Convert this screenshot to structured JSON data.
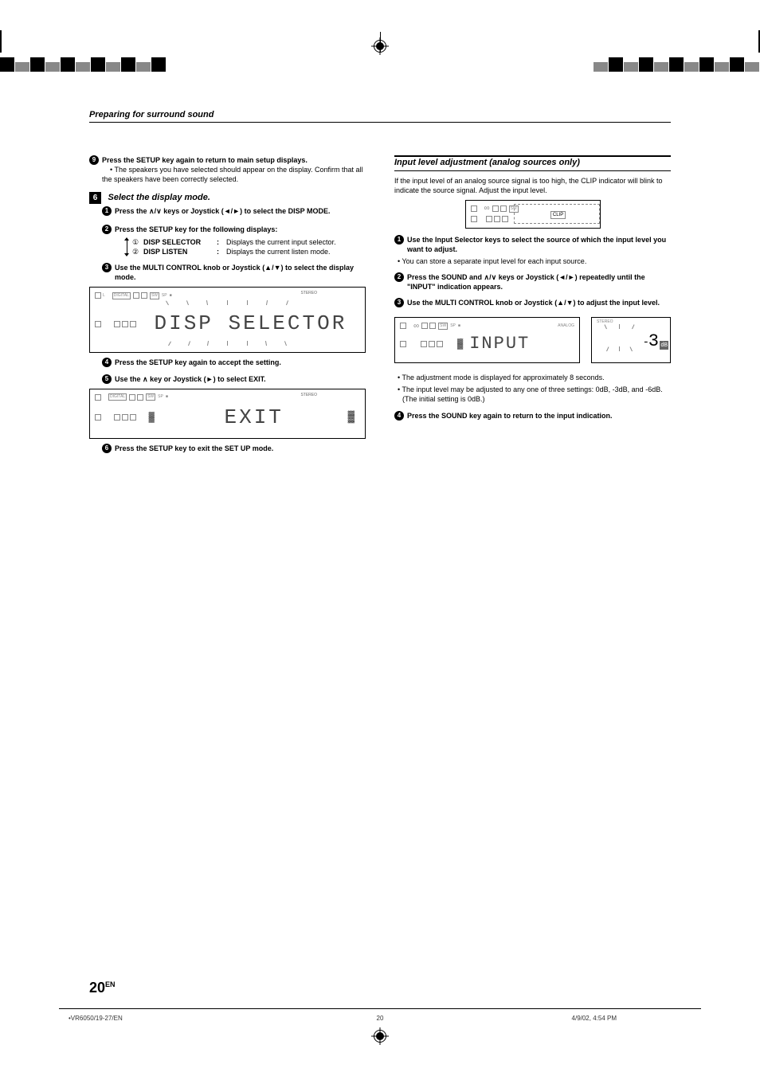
{
  "section_header": "Preparing for surround sound",
  "left": {
    "s9": {
      "head": "Press the SETUP key again to return to main setup displays.",
      "bullet": "The speakers you have selected should appear on the display. Confirm that all the speakers have been correctly selected."
    },
    "step6": {
      "heading": "Select the display mode.",
      "s1": {
        "head_a": "Press the ",
        "head_b": " keys or Joystick (",
        "head_c": ") to select the DISP MODE."
      },
      "s2": {
        "head": "Press the SETUP key for the following displays:"
      },
      "selector": {
        "row1_num": "①",
        "row1_label": "DISP SELECTOR",
        "row1_desc": "Displays the current input selector.",
        "row2_num": "②",
        "row2_label": "DISP LISTEN",
        "row2_desc": "Displays the current listen mode."
      },
      "s3": {
        "head": "Use the MULTI CONTROL knob or Joystick (▲/▼) to select the display mode."
      },
      "lcd1": {
        "stereo": "STEREO",
        "text": "DISP SELECTOR",
        "sp": "SP"
      },
      "s4": {
        "head": "Press the SETUP key again to accept the setting."
      },
      "s5": {
        "head_a": "Use the ",
        "head_b": " key or Joystick (",
        "head_c": ") to select EXIT."
      },
      "lcd2": {
        "stereo": "STEREO",
        "text": "EXIT",
        "sp": "SP"
      },
      "s6": {
        "head": "Press the SETUP key to exit the SET UP mode."
      }
    }
  },
  "right": {
    "heading": "Input level adjustment (analog sources only)",
    "intro": "If the input level of an analog source signal is too high, the CLIP indicator will blink to indicate the source signal. Adjust the input level.",
    "clip_label": "CLIP",
    "s1": {
      "head": "Use the Input Selector keys to select the source of which the input level you want to adjust.",
      "bullet": "You can store a separate input level for each input source."
    },
    "s2": {
      "head_a": "Press the SOUND and ",
      "head_b": " keys or Joystick (",
      "head_c": ") repeatedly until the \"INPUT\" indication appears."
    },
    "s3": {
      "head": "Use the MULTI CONTROL knob or Joystick (▲/▼) to adjust the input level."
    },
    "lcd": {
      "analog": "ANALOG",
      "text": "INPUT",
      "value_prefix": "-",
      "value": "3",
      "unit": "dB",
      "stereo": "STEREO",
      "sp": "SP"
    },
    "bullets": {
      "b1": "The adjustment mode is displayed for approximately 8 seconds.",
      "b2": "The input level may be adjusted to any one of three settings: 0dB, -3dB, and -6dB. (The initial setting is 0dB.)"
    },
    "s4": {
      "head": "Press the SOUND key again to return to the input indication."
    }
  },
  "icons": {
    "n9": "9",
    "n1": "1",
    "n2": "2",
    "n3": "3",
    "n4": "4",
    "n5": "5",
    "n6_box": "6",
    "n6": "6"
  },
  "glyphs": {
    "updown": "∧/∨",
    "up": "∧",
    "leftright": "◄/►",
    "right": "►"
  },
  "page_number": "20",
  "page_number_suffix": "EN",
  "footer": {
    "left": "•VR6050/19-27/EN",
    "center": "20",
    "right": "4/9/02, 4:54 PM"
  }
}
